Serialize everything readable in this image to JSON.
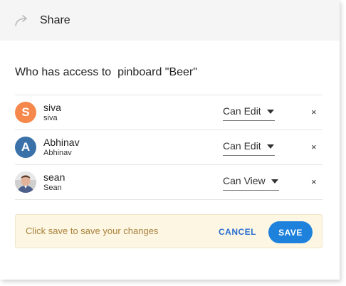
{
  "dialog": {
    "title": "Share",
    "subtitle": "Who has access to  pinboard \"Beer\""
  },
  "users": [
    {
      "initial": "S",
      "display_name": "siva",
      "login": "siva",
      "permission": "Can Edit",
      "avatar_color": "#f5884a",
      "remove_label": "×"
    },
    {
      "initial": "A",
      "display_name": "Abhinav",
      "login": "Abhinav",
      "permission": "Can Edit",
      "avatar_color": "#3a71a9",
      "remove_label": "×"
    },
    {
      "initial": "",
      "display_name": "sean",
      "login": "Sean",
      "permission": "Can View",
      "avatar_type": "photo",
      "remove_label": "×"
    }
  ],
  "footer": {
    "hint": "Click save to save your changes",
    "cancel_label": "CANCEL",
    "save_label": "SAVE"
  },
  "colors": {
    "accent": "#1e82dd",
    "hint_text": "#a9823c",
    "hint_background": "#fdf6e3"
  }
}
